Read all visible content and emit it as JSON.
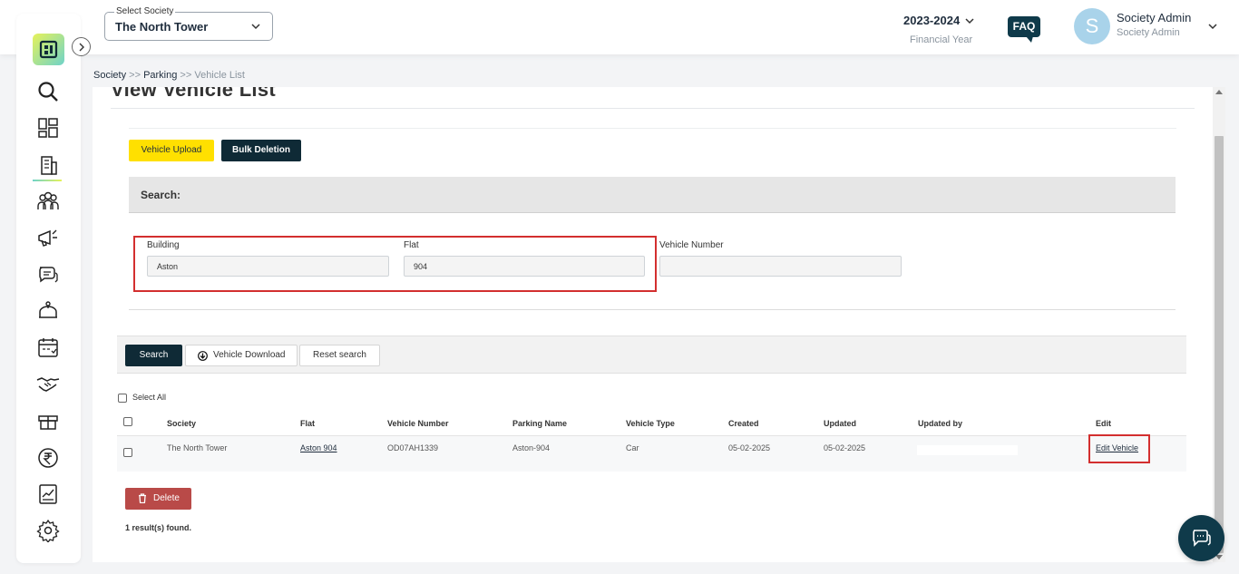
{
  "header": {
    "society_select_label": "Select Society",
    "society_select_value": "The North Tower",
    "financial_year": "2023-2024",
    "financial_year_label": "Financial Year",
    "faq_label": "FAQ",
    "avatar_initial": "S",
    "user_name": "Society Admin",
    "user_role": "Society Admin"
  },
  "sidebar": {
    "icons": [
      "logo-icon",
      "search-icon",
      "dashboard-icon",
      "building-icon",
      "members-icon",
      "announcement-icon",
      "chat-icon",
      "service-icon",
      "calendar-icon",
      "handshake-icon",
      "gift-icon",
      "rupee-icon",
      "report-icon",
      "settings-icon"
    ],
    "active": "building-icon"
  },
  "breadcrumb": {
    "items": [
      "Society",
      "Parking",
      "Vehicle List"
    ],
    "separator": ">>"
  },
  "page": {
    "title": "View Vehicle List"
  },
  "toolbar": {
    "upload_label": "Vehicle Upload",
    "bulk_delete_label": "Bulk Deletion"
  },
  "search": {
    "heading": "Search:",
    "building_label": "Building",
    "building_value": "Aston",
    "flat_label": "Flat",
    "flat_value": "904",
    "vehicle_number_label": "Vehicle Number",
    "vehicle_number_value": ""
  },
  "actions": {
    "search_label": "Search",
    "download_label": "Vehicle Download",
    "reset_label": "Reset search"
  },
  "table": {
    "select_all_label": "Select All",
    "columns": [
      "Society",
      "Flat",
      "Vehicle Number",
      "Parking Name",
      "Vehicle Type",
      "Created",
      "Updated",
      "Updated by",
      "Edit"
    ],
    "rows": [
      {
        "society": "The North Tower",
        "flat": "Aston 904",
        "vehicle_number": "OD07AH1339",
        "parking_name": "Aston-904",
        "vehicle_type": "Car",
        "created": "05-02-2025",
        "updated": "05-02-2025",
        "updated_by": "",
        "edit": "Edit Vehicle"
      }
    ]
  },
  "footer": {
    "delete_label": "Delete",
    "result_count": "1 result(s) found."
  },
  "colors": {
    "primary_dark": "#0f2a36",
    "accent_yellow": "#ffe000",
    "danger": "#b94a48",
    "highlight": "#d32f2f"
  }
}
